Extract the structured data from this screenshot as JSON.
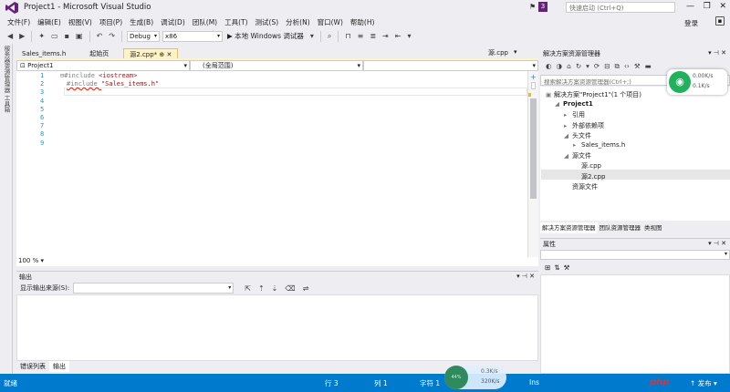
{
  "window": {
    "title": "Project1 - Microsoft Visual Studio",
    "notification_count": "3",
    "quick_launch_placeholder": "快速启动 (Ctrl+Q)",
    "controls": [
      "—",
      "❐",
      "✕"
    ]
  },
  "menu": [
    "文件(F)",
    "编辑(E)",
    "视图(V)",
    "项目(P)",
    "生成(B)",
    "调试(D)",
    "团队(M)",
    "工具(T)",
    "测试(S)",
    "分析(N)",
    "窗口(W)",
    "帮助(H)"
  ],
  "account": {
    "login": "登录"
  },
  "toolbar": {
    "config": "Debug",
    "platform": "x86",
    "run_label": "▶ 本地 Windows 调试器"
  },
  "left_strip": [
    "服务器资源管理器",
    "工具箱"
  ],
  "editor": {
    "tabs": [
      {
        "label": "Sales_items.h",
        "active": false
      },
      {
        "label": "起始页",
        "active": false
      },
      {
        "label": "源2.cpp*",
        "active": true
      }
    ],
    "right_tab": "源.cpp",
    "nav_project": "Project1",
    "nav_scope": "(全局范围)",
    "lines": [
      {
        "n": "1",
        "pp": "⊟#include ",
        "rest": "<iostream>"
      },
      {
        "n": "2",
        "pp": "#include ",
        "rest": "\"Sales_items.h\""
      },
      {
        "n": "3",
        "pp": "",
        "rest": ""
      },
      {
        "n": "4",
        "pp": "",
        "rest": ""
      },
      {
        "n": "5",
        "pp": "",
        "rest": ""
      },
      {
        "n": "6",
        "pp": "",
        "rest": ""
      },
      {
        "n": "7",
        "pp": "",
        "rest": ""
      },
      {
        "n": "8",
        "pp": "",
        "rest": ""
      },
      {
        "n": "9",
        "pp": "",
        "rest": ""
      }
    ],
    "zoom": "100 %"
  },
  "output": {
    "title": "输出",
    "source_label": "显示输出来源(S):",
    "bottom_tabs": [
      {
        "label": "错误列表",
        "active": false
      },
      {
        "label": "输出",
        "active": true
      }
    ]
  },
  "solution_explorer": {
    "title": "解决方案资源管理器",
    "search_placeholder": "搜索解决方案资源管理器(Ctrl+;)",
    "tree": [
      {
        "label": "解决方案\"Project1\"(1 个项目)",
        "indent": 0,
        "icon": "▣"
      },
      {
        "label": "Project1",
        "indent": 1,
        "icon": "◢",
        "bold": true
      },
      {
        "label": "引用",
        "indent": 2,
        "icon": "▸"
      },
      {
        "label": "外部依赖项",
        "indent": 2,
        "icon": "▸"
      },
      {
        "label": "头文件",
        "indent": 2,
        "icon": "◢"
      },
      {
        "label": "Sales_items.h",
        "indent": 3,
        "icon": "▸"
      },
      {
        "label": "源文件",
        "indent": 2,
        "icon": "◢"
      },
      {
        "label": "源.cpp",
        "indent": 3,
        "icon": ""
      },
      {
        "label": "源2.cpp",
        "indent": 3,
        "icon": ""
      },
      {
        "label": "资源文件",
        "indent": 2,
        "icon": ""
      }
    ],
    "tabs": [
      {
        "label": "解决方案资源管理器",
        "active": true
      },
      {
        "label": "团队资源管理器",
        "active": false
      },
      {
        "label": "类视图",
        "active": false
      }
    ]
  },
  "properties": {
    "title": "属性"
  },
  "status": {
    "ready": "就绪",
    "line": "行 3",
    "col": "列 1",
    "char": "字符 1",
    "ins": "Ins",
    "publish": "↑ 发布 ▾"
  },
  "network": {
    "up": "0.00K/s",
    "down": "0.1K/s",
    "up2": "0.3K/s",
    "down2": "320K/s",
    "percent": "44%"
  },
  "watermark": "php"
}
